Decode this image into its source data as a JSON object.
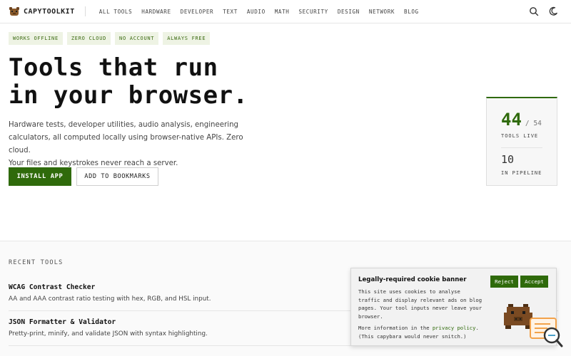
{
  "header": {
    "brand": "CAPYTOOLKIT",
    "nav": [
      "ALL TOOLS",
      "HARDWARE",
      "DEVELOPER",
      "TEXT",
      "AUDIO",
      "MATH",
      "SECURITY",
      "DESIGN",
      "NETWORK",
      "BLOG"
    ],
    "icons": [
      "search-icon",
      "moon-icon"
    ]
  },
  "hero": {
    "badges": [
      "WORKS OFFLINE",
      "ZERO CLOUD",
      "NO ACCOUNT",
      "ALWAYS FREE"
    ],
    "title_line1": "Tools that run",
    "title_line2": "in your browser.",
    "desc_line1": "Hardware tests, developer utilities, audio analysis, engineering",
    "desc_line2": "calculators, all computed locally using browser-native APIs. Zero cloud.",
    "desc_line3": "Your files and keystrokes never reach a server.",
    "primary_button": "INSTALL APP",
    "secondary_button": "ADD TO BOOKMARKS"
  },
  "stats": {
    "live_count": "44",
    "total": "/ 54",
    "live_label": "TOOLS LIVE",
    "pipeline_count": "10",
    "pipeline_label": "IN PIPELINE"
  },
  "recent": {
    "label": "RECENT TOOLS",
    "tools": [
      {
        "name": "WCAG Contrast Checker",
        "desc": "AA and AAA contrast ratio testing with hex, RGB, and HSL input."
      },
      {
        "name": "JSON Formatter & Validator",
        "desc": "Pretty-print, minify, and validate JSON with syntax highlighting."
      }
    ]
  },
  "cookie": {
    "title": "Legally-required cookie banner",
    "reject": "Reject",
    "accept": "Accept",
    "body_line1": "This site uses cookies to analyse",
    "body_line2": "traffic and display relevant ads on blog",
    "body_line3": "pages. Your tool inputs never leave your",
    "body_line4": "browser.",
    "more_prefix": "More information in the",
    "more_link": "privacy policy",
    "more_suffix": ".",
    "more_line2": "(This capybara would never snitch.)"
  },
  "colors": {
    "accent": "#2f6a0b",
    "badge_bg": "#eef3e4",
    "badge_text": "#3c6b12",
    "feedback": "#f2a24a"
  }
}
